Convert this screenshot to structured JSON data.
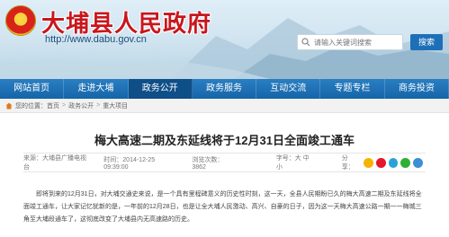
{
  "header": {
    "site_title": "大埔县人民政府",
    "site_url": "http://www.dabu.gov.cn",
    "search_placeholder": "请输入关键词搜索",
    "search_button": "搜索"
  },
  "nav": {
    "items": [
      {
        "label": "网站首页",
        "active": false
      },
      {
        "label": "走进大埔",
        "active": false
      },
      {
        "label": "政务公开",
        "active": true
      },
      {
        "label": "政务服务",
        "active": false
      },
      {
        "label": "互动交流",
        "active": false
      },
      {
        "label": "专题专栏",
        "active": false
      },
      {
        "label": "商务投资",
        "active": false
      }
    ]
  },
  "breadcrumb": {
    "prefix": "您的位置：",
    "items": [
      "首页",
      "政务公开",
      "重大项目"
    ]
  },
  "article": {
    "title": "梅大高速二期及东延线将于12月31日全面竣工通车",
    "source": "来源：大埔县广播电视台",
    "time": "时间：2014-12-25 09:39:00",
    "views": "浏览次数：3862",
    "font_size": "字号：大 中 小",
    "share": "分享：",
    "paragraphs": [
      "即将到来的12月31日，对大埔交通史来说，是一个具有里程碑意义的历史性时刻，这一天，全县人民期盼已久的梅大高速二期及东延线将全面竣工通车，让大家记忆犹新的是，一年前的12月28日，也是让全大埔人民激动、高兴、自豪的日子，因为这一天梅大高速公路一期一一梅城三角至大埔段通车了，这彻底改变了大埔县内无高速路的历史。"
    ]
  },
  "colors": {
    "title_red": "#c8161d",
    "nav_blue": "#1565a8",
    "nav_active": "#0f4f88"
  }
}
